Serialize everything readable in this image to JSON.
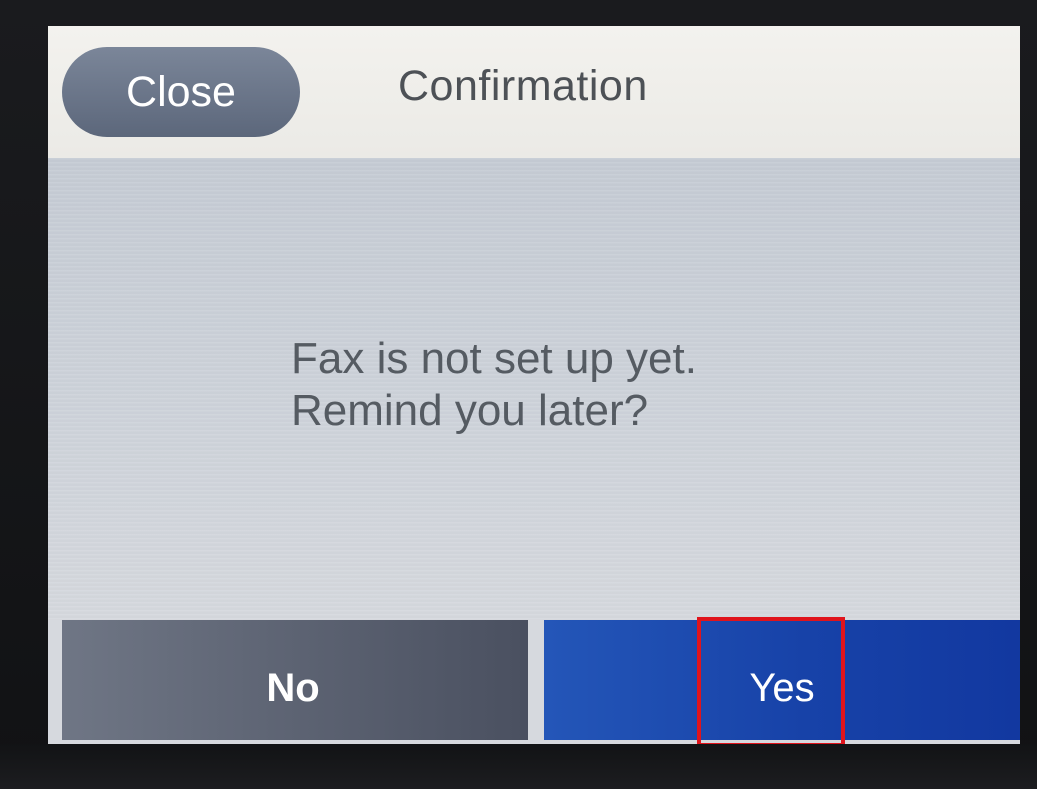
{
  "topbar": {
    "close_label": "Close",
    "title": "Confirmation"
  },
  "dialog": {
    "message_line1": "Fax is not set up yet.",
    "message_line2": "Remind you later?"
  },
  "actions": {
    "no_label": "No",
    "yes_label": "Yes"
  },
  "colors": {
    "highlight_border": "#e0141c",
    "yes_button": "#1742a8",
    "no_button": "#5a6070",
    "close_button": "#6b768a"
  }
}
